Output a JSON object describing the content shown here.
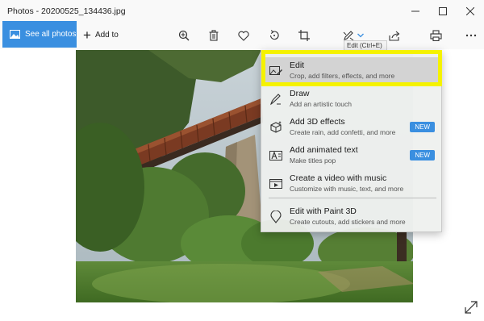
{
  "window": {
    "title": "Photos - 20200525_134436.jpg"
  },
  "toolbar": {
    "see_all_label": "See all photos",
    "add_to_label": "Add to",
    "icons": [
      "zoom-in-icon",
      "delete-icon",
      "favorite-icon",
      "rotate-icon",
      "crop-icon",
      "edit-draw-icon",
      "chevron-down-icon",
      "share-icon",
      "print-icon",
      "more-icon"
    ]
  },
  "tooltip": {
    "text": "Edit (Ctrl+E)"
  },
  "menu": {
    "items": [
      {
        "title": "Edit",
        "desc": "Crop, add filters, effects, and more",
        "icon": "edit-image-icon",
        "badge": ""
      },
      {
        "title": "Draw",
        "desc": "Add an artistic touch",
        "icon": "pen-icon",
        "badge": ""
      },
      {
        "title": "Add 3D effects",
        "desc": "Create rain, add confetti, and more",
        "icon": "3d-effects-icon",
        "badge": "NEW"
      },
      {
        "title": "Add animated text",
        "desc": "Make titles pop",
        "icon": "animated-text-icon",
        "badge": "NEW"
      },
      {
        "title": "Create a video with music",
        "desc": "Customize with music, text, and more",
        "icon": "video-icon",
        "badge": ""
      },
      {
        "title": "Edit with Paint 3D",
        "desc": "Create cutouts, add stickers and more",
        "icon": "paint3d-icon",
        "badge": ""
      }
    ]
  },
  "colors": {
    "accent": "#3a8fe0",
    "highlight": "#f5f200"
  }
}
